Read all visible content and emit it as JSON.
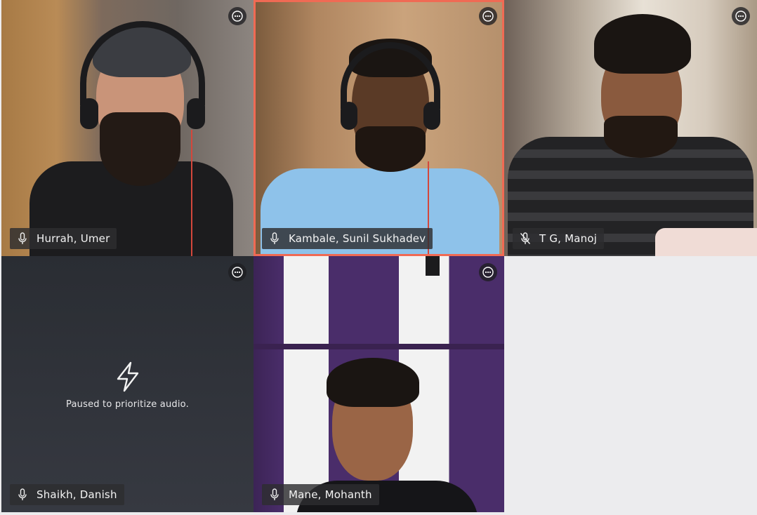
{
  "participants": [
    {
      "name": "Hurrah, Umer",
      "mic": "on",
      "video": "on",
      "active": false
    },
    {
      "name": "Kambale, Sunil Sukhadev",
      "mic": "on",
      "video": "on",
      "active": true
    },
    {
      "name": "T G, Manoj",
      "mic": "muted",
      "video": "on",
      "active": false
    },
    {
      "name": "Shaikh, Danish",
      "mic": "on",
      "video": "paused",
      "active": false
    },
    {
      "name": "Mane, Mohanth",
      "mic": "on",
      "video": "on",
      "active": false
    }
  ],
  "paused_message": "Paused to prioritize audio.",
  "icons": {
    "more": "more-options-icon",
    "mic": "microphone-icon",
    "mic_muted": "microphone-muted-icon",
    "paused": "lightning-bolt-icon"
  },
  "colors": {
    "active_border": "#f06a54",
    "name_tag_bg": "#2d2d30",
    "empty_tile": "#ececee",
    "paused_tile": "#2e3138"
  }
}
